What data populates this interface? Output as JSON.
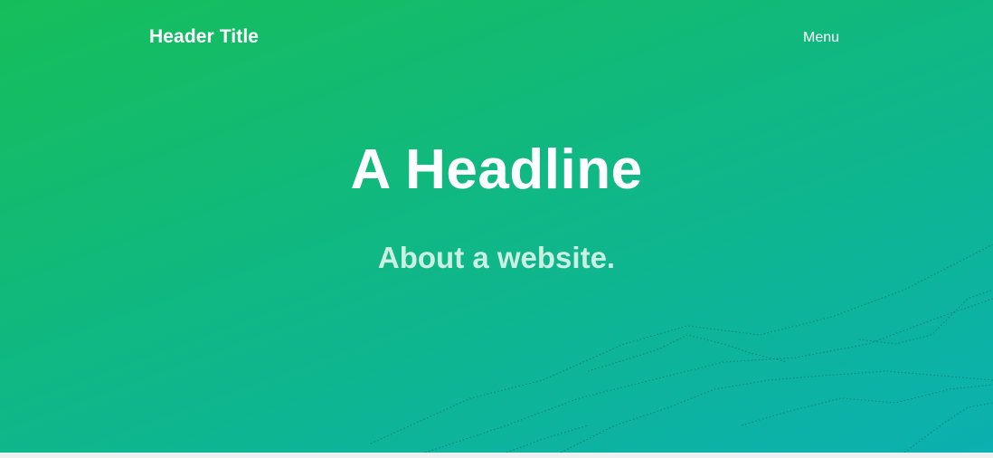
{
  "header": {
    "title": "Header Title",
    "menu_label": "Menu"
  },
  "hero": {
    "headline": "A Headline",
    "subheadline": "About a website."
  },
  "colors": {
    "gradient_start": "#16be5a",
    "gradient_mid": "#10b882",
    "gradient_end": "#0bb0b0",
    "text": "#ffffff"
  }
}
